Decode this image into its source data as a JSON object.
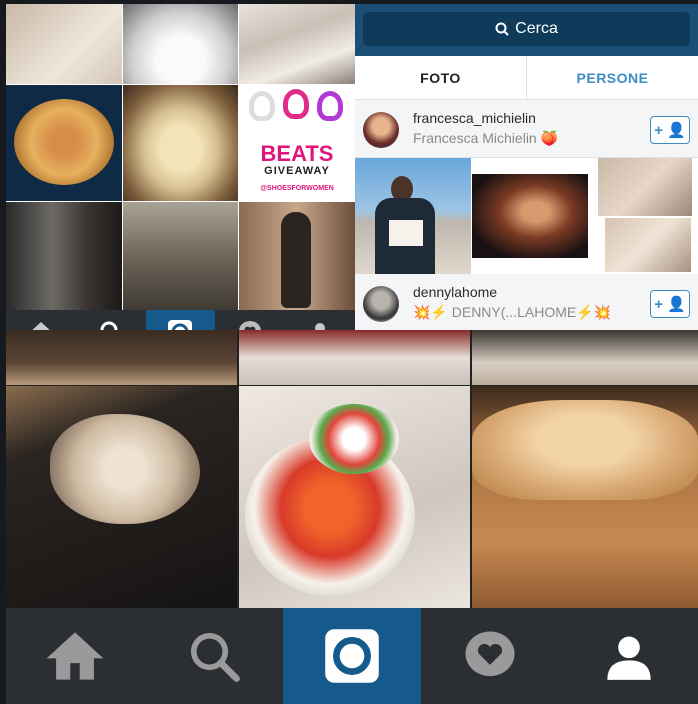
{
  "search": {
    "label": "Cerca"
  },
  "segment": {
    "foto": "FOTO",
    "persone": "PERSONE"
  },
  "users": [
    {
      "username": "francesca_michielin",
      "fullname": "Francesca Michielin 🍑"
    },
    {
      "username": "dennylahome",
      "fullname": "💥⚡ DENNY(...LAHOME⚡💥"
    }
  ],
  "follow": {
    "label": "+ 👤"
  },
  "beats": {
    "brand": "BEATS",
    "sub": "GIVEAWAY",
    "handle": "@SHOESFORWOMEN"
  },
  "tabs": [
    "home-icon",
    "search-icon",
    "camera-icon",
    "activity-icon",
    "profile-icon"
  ],
  "colors": {
    "tab_active": "#165a8d",
    "tab_bg": "#2b2f33",
    "accent": "#3c8ec4"
  }
}
